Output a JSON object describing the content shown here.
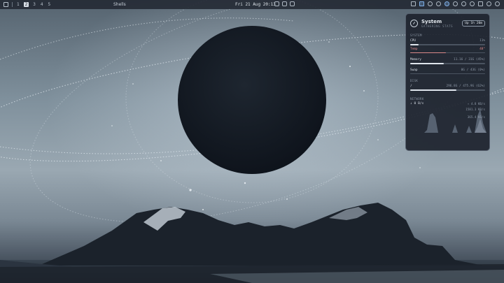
{
  "topbar": {
    "workspaces": [
      {
        "label": "1"
      },
      {
        "label": "2"
      },
      {
        "label": "3"
      },
      {
        "label": "4"
      },
      {
        "label": "5"
      }
    ],
    "window_title": "Shells",
    "clock": "Fri 21 Aug 20:13"
  },
  "widget": {
    "title": "System",
    "subtitle": "GATHERING STATS",
    "uptime": "Up 1h 20m",
    "section_system": "SYSTEM",
    "cpu": {
      "label": "CPU",
      "value": "11%",
      "fraction": 0.11
    },
    "temp": {
      "label": "Temp",
      "value": "48°",
      "fraction": 0.48
    },
    "memory": {
      "label": "Memory",
      "value": "11.16 / 31G (45%)",
      "fraction": 0.45
    },
    "swap": {
      "label": "Swap",
      "value": "0G / 43G (0%)",
      "fraction": 0.0
    },
    "section_disk": "DISK",
    "disk": {
      "label": "/",
      "value": "296.8G / 475.9G (62%)",
      "fraction": 0.62
    },
    "section_network": "NETWORK",
    "net_down": "↓ 0 B/s",
    "net_up": "↑ 4.8 KB/s",
    "net_total1": "1581.3 KB/s",
    "net_total2": "365.4 KB/s"
  },
  "colors": {
    "accent": "#dfe5ec",
    "temp": "#d98888",
    "widget_bg": "#1e242e"
  }
}
